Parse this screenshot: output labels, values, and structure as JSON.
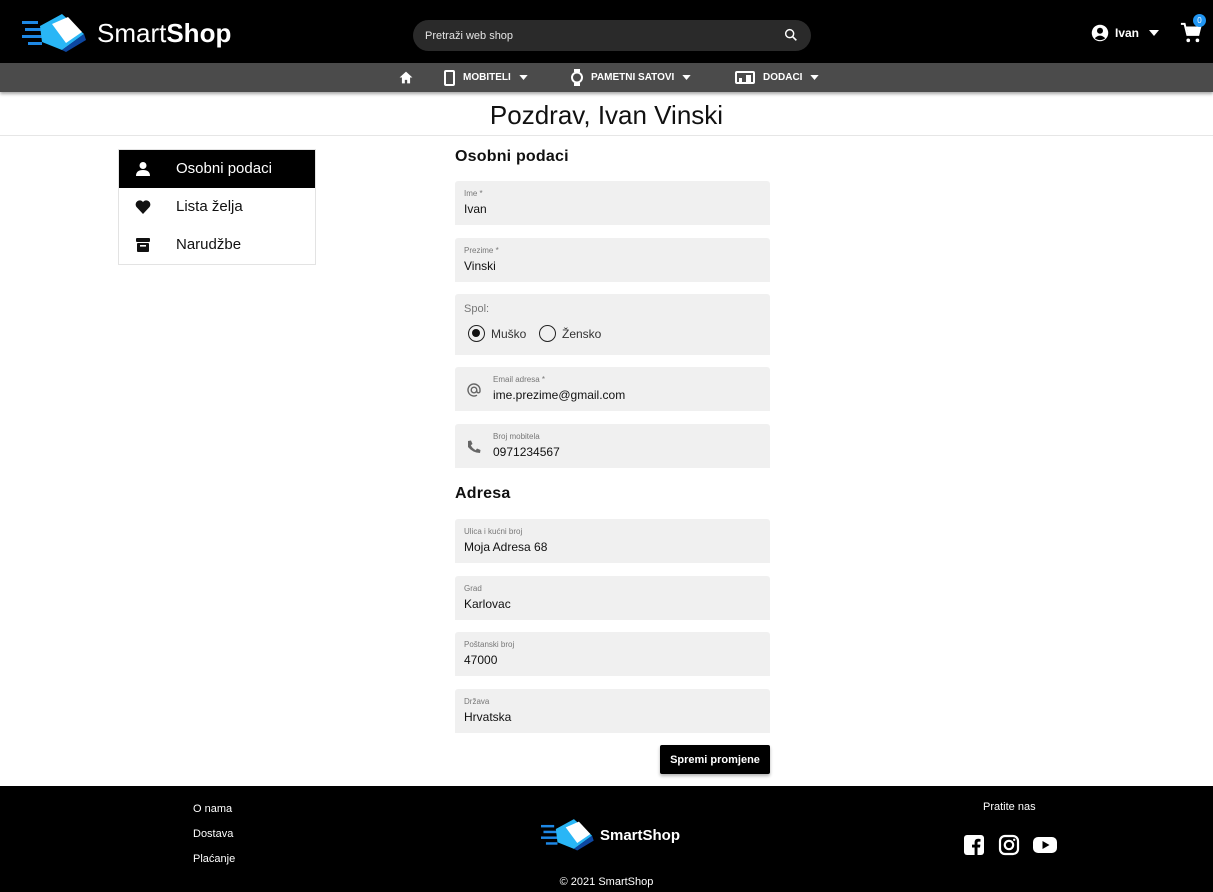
{
  "header": {
    "logo_light": "Smart",
    "logo_bold": "Shop",
    "search_placeholder": "Pretraži web shop",
    "user_name": "Ivan",
    "cart_count": "0"
  },
  "nav": {
    "items": [
      {
        "label": "MOBITELI",
        "icon": "phone-icon"
      },
      {
        "label": "PAMETNI SATOVI",
        "icon": "watch-icon"
      },
      {
        "label": "DODACI",
        "icon": "accessories-icon"
      }
    ]
  },
  "greeting": "Pozdrav, Ivan Vinski",
  "sidebar": {
    "items": [
      {
        "label": "Osobni podaci",
        "icon": "person-icon",
        "active": true
      },
      {
        "label": "Lista želja",
        "icon": "heart-icon"
      },
      {
        "label": "Narudžbe",
        "icon": "archive-icon"
      }
    ]
  },
  "personal": {
    "title": "Osobni podaci",
    "first_name": {
      "label": "Ime *",
      "value": "Ivan"
    },
    "last_name": {
      "label": "Prezime *",
      "value": "Vinski"
    },
    "gender": {
      "label": "Spol:",
      "options": [
        "Muško",
        "Žensko"
      ],
      "selected": "Muško"
    },
    "email": {
      "label": "Email adresa *",
      "value": "ime.prezime@gmail.com"
    },
    "phone": {
      "label": "Broj mobitela",
      "value": "0971234567"
    }
  },
  "address": {
    "title": "Adresa",
    "street": {
      "label": "Ulica i kućni broj",
      "value": "Moja Adresa 68"
    },
    "city": {
      "label": "Grad",
      "value": "Karlovac"
    },
    "postal": {
      "label": "Poštanski broj",
      "value": "47000"
    },
    "country": {
      "label": "Država",
      "value": "Hrvatska"
    }
  },
  "save_label": "Spremi promjene",
  "footer": {
    "links": [
      "O nama",
      "Dostava",
      "Plaćanje"
    ],
    "logo_text": "SmartShop",
    "follow": "Pratite nas",
    "copyright": "© 2021 SmartShop"
  },
  "colors": {
    "header_bg": "#000000",
    "nav_bg": "#4b4b4b",
    "field_bg": "#f0f0f0",
    "accent_blue": "#2196f3",
    "logo_cyan": "#1fb6ff"
  }
}
